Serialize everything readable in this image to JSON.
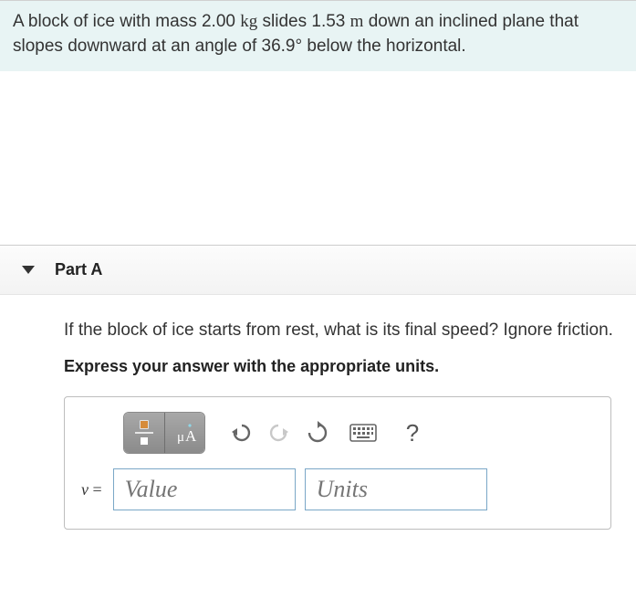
{
  "problem": {
    "pre1": "A block of ice with mass ",
    "mass": "2.00",
    "mass_unit": "kg",
    "mid1": " slides ",
    "dist": "1.53",
    "dist_unit": "m",
    "mid2": " down an inclined plane that slopes downward at an angle of ",
    "angle": "36.9",
    "deg": "°",
    "post": " below the horizontal."
  },
  "part": {
    "label": "Part A",
    "question": "If the block of ice starts from rest, what is its final speed? Ignore friction.",
    "instruction": "Express your answer with the appropriate units."
  },
  "answer": {
    "var": "v",
    "equals": " = ",
    "value_placeholder": "Value",
    "units_placeholder": "Units"
  },
  "toolbar": {
    "help": "?"
  }
}
